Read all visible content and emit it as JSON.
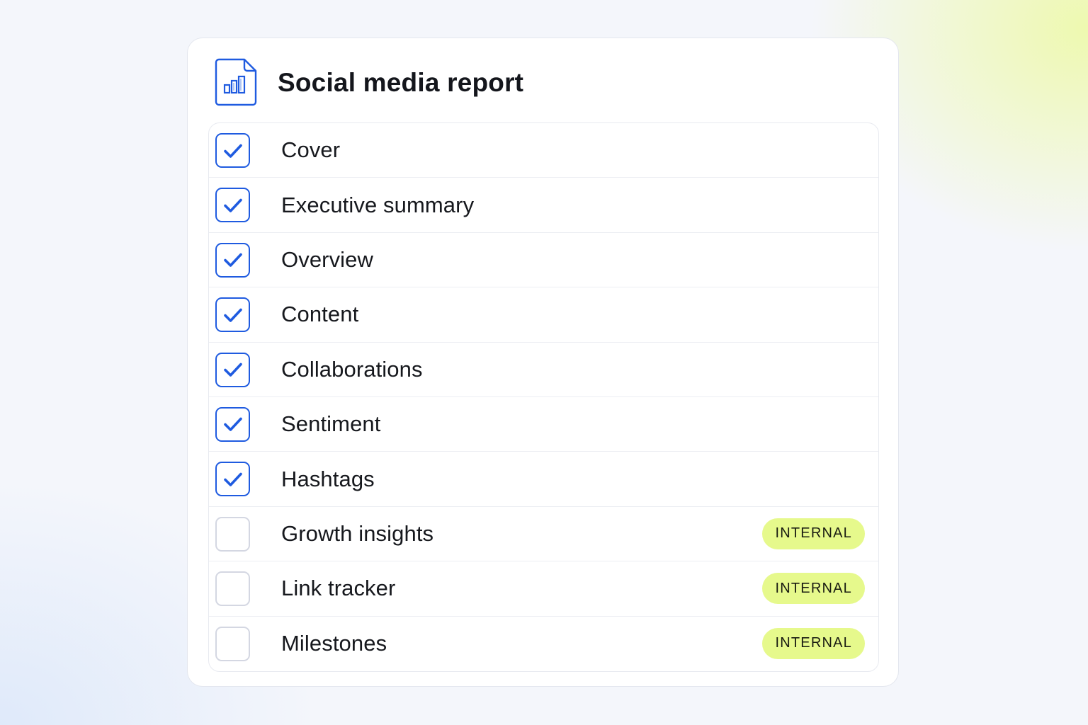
{
  "report": {
    "title": "Social media report",
    "icon": "chart-document-icon",
    "accent_color": "#1f5be0",
    "badge_color": "#e6f98c",
    "items": [
      {
        "label": "Cover",
        "checked": true,
        "badge": ""
      },
      {
        "label": "Executive summary",
        "checked": true,
        "badge": ""
      },
      {
        "label": "Overview",
        "checked": true,
        "badge": ""
      },
      {
        "label": "Content",
        "checked": true,
        "badge": ""
      },
      {
        "label": "Collaborations",
        "checked": true,
        "badge": ""
      },
      {
        "label": "Sentiment",
        "checked": true,
        "badge": ""
      },
      {
        "label": "Hashtags",
        "checked": true,
        "badge": ""
      },
      {
        "label": "Growth insights",
        "checked": false,
        "badge": "INTERNAL"
      },
      {
        "label": "Link tracker",
        "checked": false,
        "badge": "INTERNAL"
      },
      {
        "label": "Milestones",
        "checked": false,
        "badge": "INTERNAL"
      }
    ]
  }
}
